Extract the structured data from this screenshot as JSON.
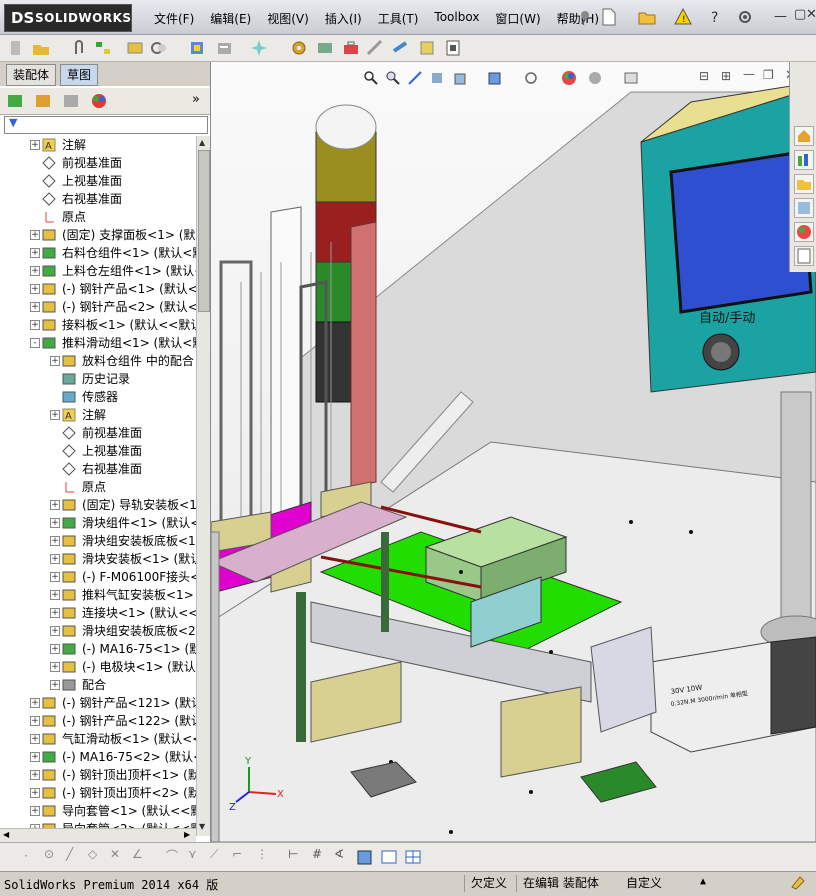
{
  "app": {
    "title_logo_prefix": "DS",
    "title_logo": "SOLIDWORKS"
  },
  "menu": [
    "文件(F)",
    "编辑(E)",
    "视图(V)",
    "插入(I)",
    "工具(T)",
    "Toolbox",
    "窗口(W)",
    "帮助(H)"
  ],
  "tabs": {
    "assembly": "装配体",
    "sketch": "草图"
  },
  "tree": [
    {
      "level": 0,
      "icon": "annotation-icon",
      "label": "注解",
      "expander": "+"
    },
    {
      "level": 0,
      "icon": "plane-icon",
      "label": "前视基准面"
    },
    {
      "level": 0,
      "icon": "plane-icon",
      "label": "上视基准面"
    },
    {
      "level": 0,
      "icon": "plane-icon",
      "label": "右视基准面"
    },
    {
      "level": 0,
      "icon": "origin-icon",
      "label": "原点"
    },
    {
      "level": 0,
      "icon": "part-icon",
      "label": "(固定) 支撑面板<1> (默认<",
      "expander": "+"
    },
    {
      "level": 0,
      "icon": "assembly-icon",
      "label": "右料仓组件<1> (默认<默",
      "expander": "+"
    },
    {
      "level": 0,
      "icon": "assembly-icon",
      "label": "上料仓左组件<1> (默认<",
      "expander": "+"
    },
    {
      "level": 0,
      "icon": "part-icon",
      "label": "(-) 钢针产品<1> (默认<",
      "expander": "+"
    },
    {
      "level": 0,
      "icon": "part-icon",
      "label": "(-) 钢针产品<2> (默认<",
      "expander": "+"
    },
    {
      "level": 0,
      "icon": "part-icon",
      "label": "接料板<1> (默认<<默认>",
      "expander": "+"
    },
    {
      "level": 0,
      "icon": "assembly-icon",
      "label": "推料滑动组<1> (默认<默",
      "expander": "-"
    },
    {
      "level": 1,
      "icon": "folder-icon",
      "label": "放料仓组件 中的配合",
      "expander": "+"
    },
    {
      "level": 1,
      "icon": "history-icon",
      "label": "历史记录"
    },
    {
      "level": 1,
      "icon": "sensor-icon",
      "label": "传感器"
    },
    {
      "level": 1,
      "icon": "annotation-icon",
      "label": "注解",
      "expander": "+"
    },
    {
      "level": 1,
      "icon": "plane-icon",
      "label": "前视基准面"
    },
    {
      "level": 1,
      "icon": "plane-icon",
      "label": "上视基准面"
    },
    {
      "level": 1,
      "icon": "plane-icon",
      "label": "右视基准面"
    },
    {
      "level": 1,
      "icon": "origin-icon",
      "label": "原点"
    },
    {
      "level": 1,
      "icon": "part-icon",
      "label": "(固定) 导轨安装板<1",
      "expander": "+"
    },
    {
      "level": 1,
      "icon": "assembly-icon",
      "label": "滑块组件<1> (默认<<",
      "expander": "+"
    },
    {
      "level": 1,
      "icon": "part-icon",
      "label": "滑块组安装板底板<1",
      "expander": "+"
    },
    {
      "level": 1,
      "icon": "part-icon",
      "label": "滑块安装板<1> (默认",
      "expander": "+"
    },
    {
      "level": 1,
      "icon": "part-icon",
      "label": "(-) F-M06100F接头<1",
      "expander": "+"
    },
    {
      "level": 1,
      "icon": "part-icon",
      "label": "推料气缸安装板<1> (",
      "expander": "+"
    },
    {
      "level": 1,
      "icon": "part-icon",
      "label": "连接块<1> (默认<<默",
      "expander": "+"
    },
    {
      "level": 1,
      "icon": "part-icon",
      "label": "滑块组安装板底板<2>",
      "expander": "+"
    },
    {
      "level": 1,
      "icon": "assembly-icon",
      "label": "(-) MA16-75<1> (默认",
      "expander": "+"
    },
    {
      "level": 1,
      "icon": "part-icon",
      "label": "(-) 电极块<1> (默认",
      "expander": "+"
    },
    {
      "level": 1,
      "icon": "mates-icon",
      "label": "配合",
      "expander": "+"
    },
    {
      "level": 0,
      "icon": "part-icon",
      "label": "(-) 钢针产品<121> (默认",
      "expander": "+"
    },
    {
      "level": 0,
      "icon": "part-icon",
      "label": "(-) 钢针产品<122> (默认",
      "expander": "+"
    },
    {
      "level": 0,
      "icon": "part-icon",
      "label": "气缸滑动板<1> (默认<<",
      "expander": "+"
    },
    {
      "level": 0,
      "icon": "assembly-icon",
      "label": "(-) MA16-75<2> (默认<",
      "expander": "+"
    },
    {
      "level": 0,
      "icon": "part-icon",
      "label": "(-) 钢针顶出顶杆<1> (默",
      "expander": "+"
    },
    {
      "level": 0,
      "icon": "part-icon",
      "label": "(-) 钢针顶出顶杆<2> (默",
      "expander": "+"
    },
    {
      "level": 0,
      "icon": "part-icon",
      "label": "导向套管<1> (默认<<默认",
      "expander": "+"
    },
    {
      "level": 0,
      "icon": "part-icon",
      "label": "导向套管<2> (默认<<默认",
      "expander": "+"
    }
  ],
  "viewport": {
    "panel_text": "自动/手动",
    "motor_label_1": "30V 10W",
    "motor_label_2": "0.32N.M 3000r/min 单相型",
    "triad": {
      "x": "X",
      "y": "Y",
      "z": "Z"
    }
  },
  "status": {
    "product": "SolidWorks Premium 2014 x64 版",
    "definition": "欠定义",
    "mode": "在编辑 装配体",
    "units": "自定义"
  },
  "colors": {
    "accent": "#3c6eb4",
    "green": "#22dd00",
    "magenta": "#e000d0",
    "teal": "#1ba3a3"
  }
}
